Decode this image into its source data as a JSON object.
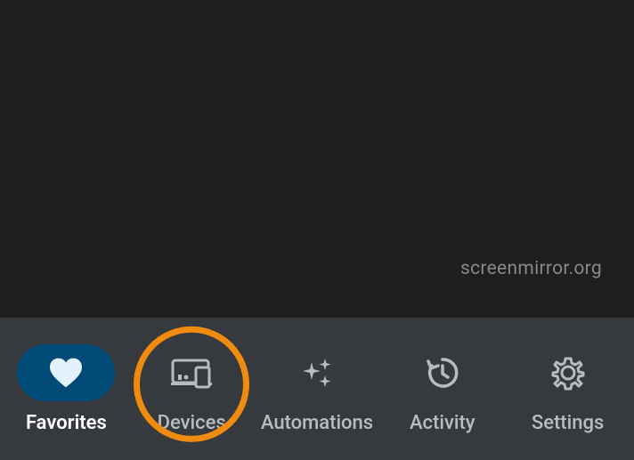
{
  "watermark": "screenmirror.org",
  "tabs": {
    "favorites": {
      "label": "Favorites"
    },
    "devices": {
      "label": "Devices"
    },
    "automations": {
      "label": "Automations"
    },
    "activity": {
      "label": "Activity"
    },
    "settings": {
      "label": "Settings"
    }
  }
}
